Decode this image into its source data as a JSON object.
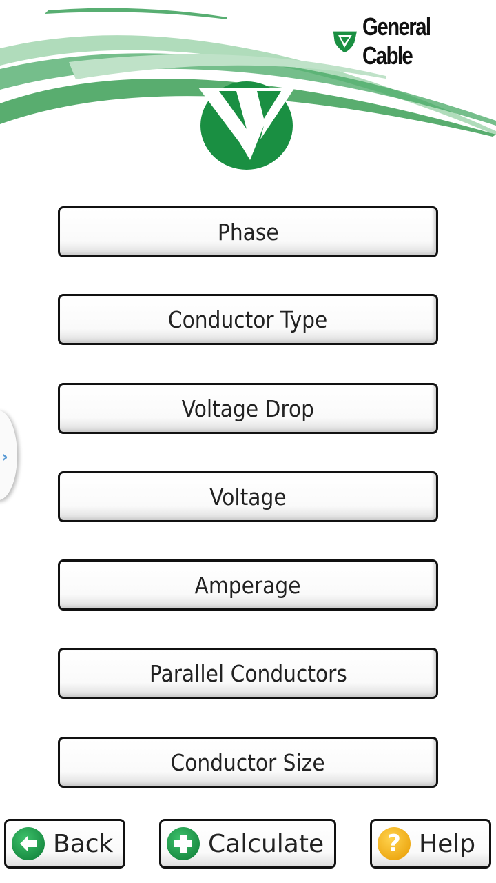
{
  "brand": {
    "name": "General Cable",
    "logo_color": "#1a8f42"
  },
  "options": [
    "Phase",
    "Conductor Type",
    "Voltage Drop",
    "Voltage",
    "Amperage",
    "Parallel Conductors",
    "Conductor Size"
  ],
  "footer": {
    "back": "Back",
    "calculate": "Calculate",
    "help": "Help",
    "help_icon_glyph": "?"
  },
  "drawer": {
    "icon": "chevron-right-icon",
    "glyph": "›"
  }
}
